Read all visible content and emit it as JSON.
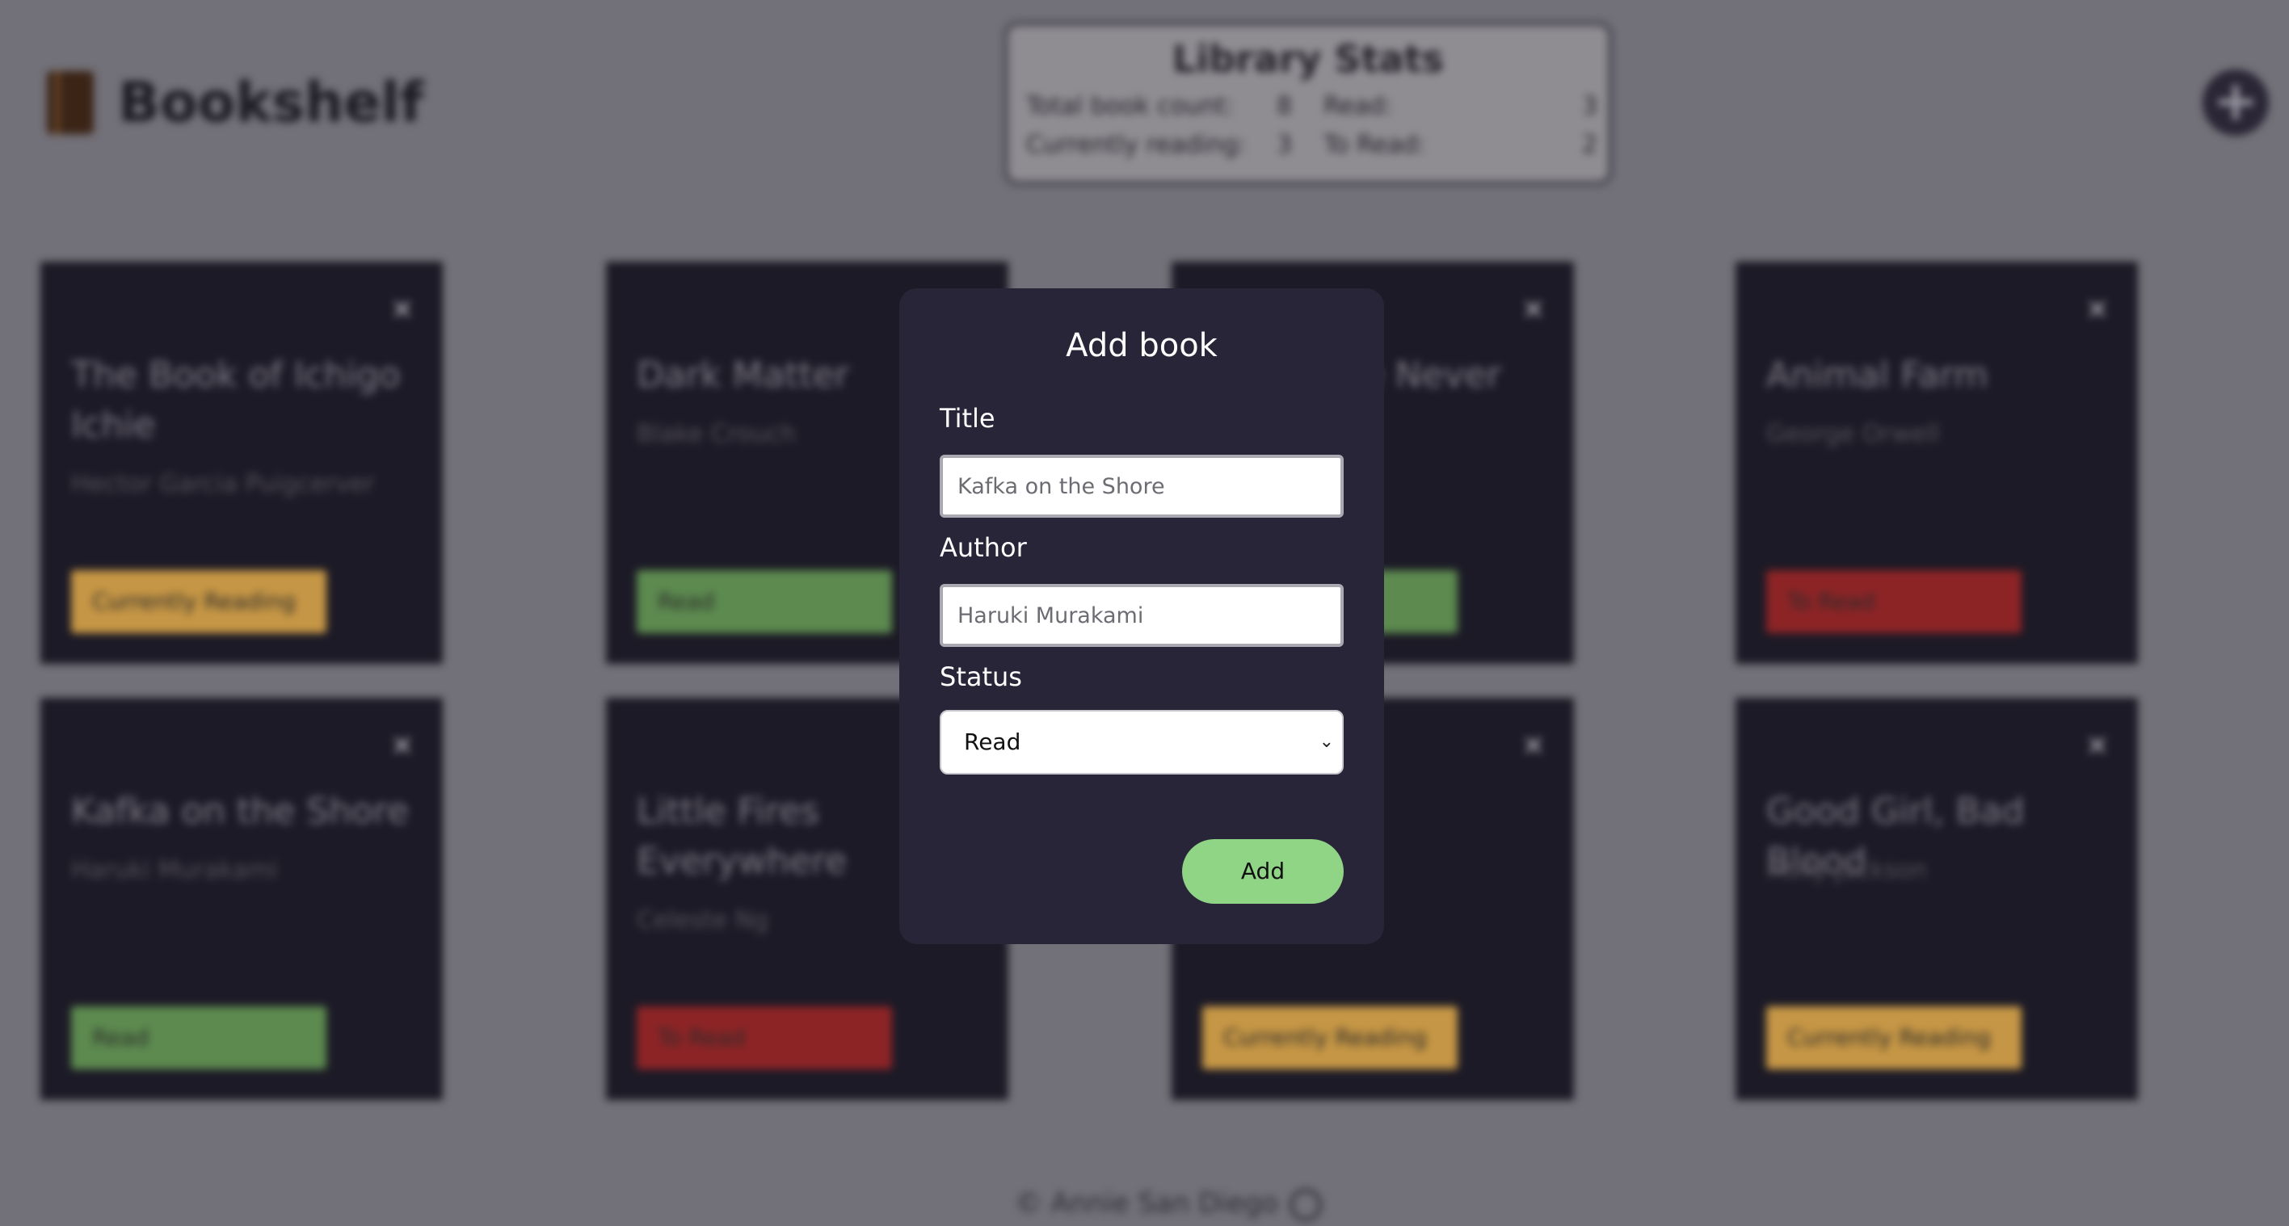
{
  "header": {
    "app_title": "Bookshelf",
    "logo_icon": "book-icon",
    "add_icon": "plus-circle-icon"
  },
  "stats": {
    "title": "Library Stats",
    "total_label": "Total book count:",
    "total_value": "8",
    "read_label": "Read:",
    "read_value": "3",
    "reading_label": "Currently reading:",
    "reading_value": "3",
    "toread_label": "To Read:",
    "toread_value": "2"
  },
  "books": [
    {
      "title": "The Book of Ichigo Ichie",
      "author": "Hector Garcia Puigcerver",
      "status": "Currently Reading"
    },
    {
      "title": "Dark Matter",
      "author": "Blake Crouch",
      "status": "Read"
    },
    {
      "title": "Where We Never Stay",
      "author": "",
      "status": "Read"
    },
    {
      "title": "Animal Farm",
      "author": "George Orwell",
      "status": "To Read"
    },
    {
      "title": "Kafka on the Shore",
      "author": "Haruki Murakami",
      "status": "Read"
    },
    {
      "title": "Little Fires Everywhere",
      "author": "Celeste Ng",
      "status": "To Read"
    },
    {
      "title": "",
      "author": "",
      "status": "Currently Reading"
    },
    {
      "title": "Good Girl, Bad Blood",
      "author": "Holly Jackson",
      "status": "Currently Reading"
    }
  ],
  "footer": {
    "text": "© Annie San Diego",
    "icon": "github-icon"
  },
  "modal": {
    "title": "Add book",
    "title_label": "Title",
    "title_placeholder": "Kafka on the Shore",
    "author_label": "Author",
    "author_placeholder": "Haruki Murakami",
    "status_label": "Status",
    "status_selected": "Read",
    "add_label": "Add"
  },
  "colors": {
    "modal_bg": "#292538",
    "add_button": "#90d486",
    "status_reading": "#c59645",
    "status_read": "#5c8a4f",
    "status_toread": "#8c2426"
  }
}
